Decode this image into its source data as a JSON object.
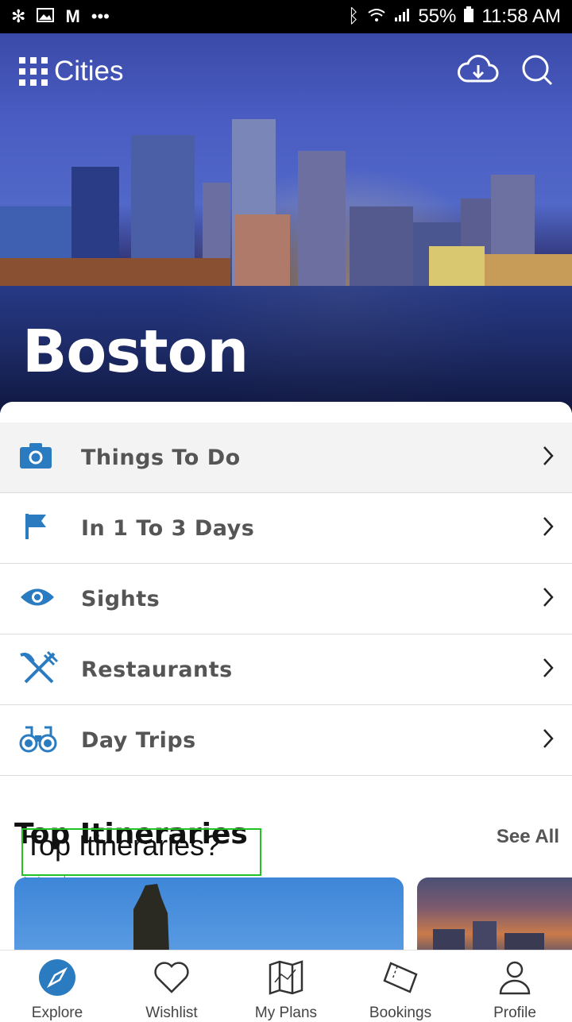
{
  "status_bar": {
    "battery": "55%",
    "time": "11:58 AM",
    "more": "•••"
  },
  "header": {
    "brand": "Cities",
    "city_name": "Boston"
  },
  "menu": {
    "items": [
      {
        "label": "Things To Do",
        "icon": "camera-icon"
      },
      {
        "label": "In 1 To 3 Days",
        "icon": "flag-icon"
      },
      {
        "label": "Sights",
        "icon": "eye-icon"
      },
      {
        "label": "Restaurants",
        "icon": "utensils-icon"
      },
      {
        "label": "Day Trips",
        "icon": "binoculars-icon"
      }
    ]
  },
  "itineraries": {
    "title": "Top Itineraries",
    "see_all": "See All",
    "overlay_text": "Top Itineraries?",
    "overlap_note": "text overlap"
  },
  "bottom_nav": {
    "items": [
      {
        "label": "Explore",
        "icon": "compass-icon"
      },
      {
        "label": "Wishlist",
        "icon": "heart-icon"
      },
      {
        "label": "My Plans",
        "icon": "map-icon"
      },
      {
        "label": "Bookings",
        "icon": "ticket-icon"
      },
      {
        "label": "Profile",
        "icon": "user-icon"
      }
    ]
  },
  "colors": {
    "accent": "#2b7bc0",
    "text": "#555555"
  }
}
